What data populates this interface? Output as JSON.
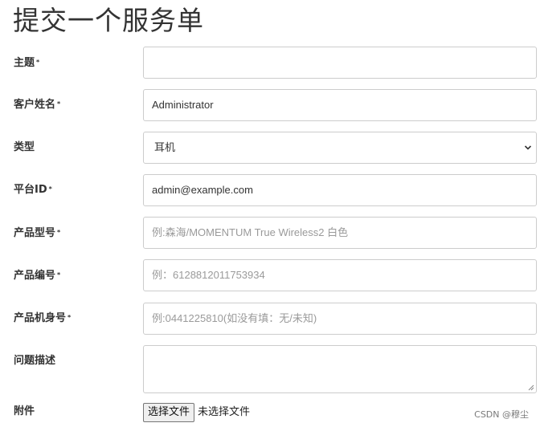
{
  "page": {
    "title": "提交一个服务单"
  },
  "form": {
    "required_mark": "*",
    "subject": {
      "label": "主题",
      "value": ""
    },
    "customer_name": {
      "label": "客户姓名",
      "value": "Administrator"
    },
    "type": {
      "label": "类型",
      "selected": "耳机"
    },
    "platform_id": {
      "label": "平台ID",
      "value": "admin@example.com"
    },
    "product_model": {
      "label": "产品型号",
      "placeholder": "例:森海/MOMENTUM True Wireless2 白色"
    },
    "product_code": {
      "label": "产品编号",
      "placeholder": "例：6128812011753934"
    },
    "serial_number": {
      "label": "产品机身号",
      "placeholder": "例:0441225810(如没有填：无/未知)"
    },
    "description": {
      "label": "问题描述",
      "value": ""
    },
    "attachment": {
      "label": "附件",
      "button_label": "选择文件",
      "status_text": "未选择文件"
    }
  },
  "watermark": {
    "text": "CSDN @穆尘"
  },
  "icons": {
    "dropdown": "chevron-down-icon",
    "textarea_resize": "resize-grip-icon"
  },
  "colors": {
    "text": "#333333",
    "placeholder": "#9a9a9a",
    "border": "#cccccc",
    "button_bg": "#efefef"
  }
}
